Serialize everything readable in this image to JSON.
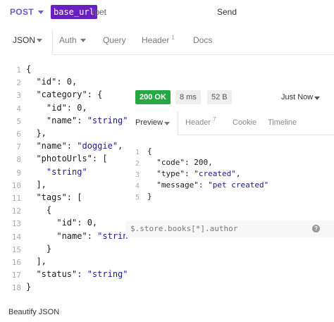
{
  "url_bar": {
    "method": "POST",
    "base": "base_url",
    "path": "/pet",
    "send_label": "Send"
  },
  "request_tabs": [
    {
      "label": "JSON"
    },
    {
      "label": "Auth"
    },
    {
      "label": "Query"
    },
    {
      "label": "Header",
      "count": "1"
    },
    {
      "label": "Docs"
    }
  ],
  "body_lines": {
    "numbers": [
      "1",
      "2",
      "3",
      "4",
      "5",
      "6",
      "7",
      "8",
      "9",
      "10",
      "11",
      "12",
      "13",
      "14",
      "15",
      "16",
      "17",
      "18"
    ]
  },
  "response": {
    "status": "200 OK",
    "time": "8 ms",
    "size": "52 B",
    "history_label": "Just Now",
    "tabs": [
      {
        "label": "Preview"
      },
      {
        "label": "Header",
        "count": "7"
      },
      {
        "label": "Cookie"
      },
      {
        "label": "Timeline"
      }
    ],
    "line_numbers": [
      "1",
      "2",
      "3",
      "4",
      "5"
    ],
    "filter_placeholder": "$.store.books[*].author"
  },
  "footer": {
    "beautify_label": "Beautify JSON"
  },
  "colors": {
    "accent": "#6a1fc4",
    "method": "#6a5acd",
    "status_ok": "#28a745",
    "string": "#1c1a8a"
  }
}
